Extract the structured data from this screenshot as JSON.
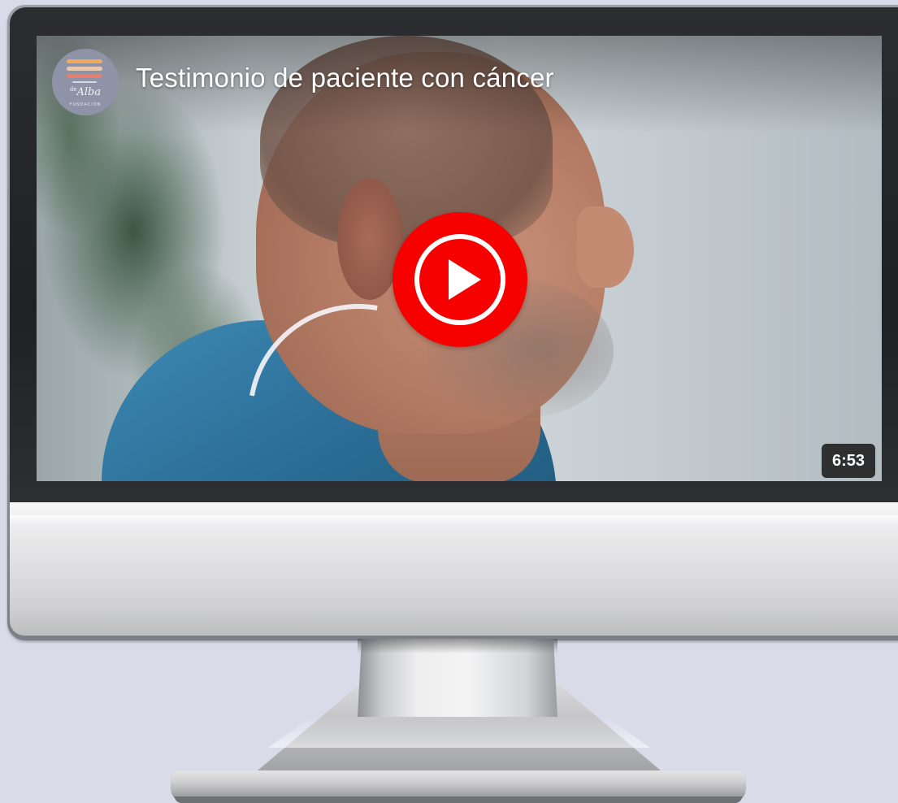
{
  "video": {
    "title": "Testimonio de paciente con cáncer",
    "duration": "6:53",
    "channel_avatar": {
      "script_text": "Alba",
      "prefix_text": "de",
      "small_text": "FUNDACIÓN"
    },
    "play_button_icon": "youtube-music-play-icon"
  },
  "colors": {
    "page_background": "#d9dbe9",
    "play_button": "#f70000",
    "bezel": "#1f2124",
    "chin": "#dcdcde"
  }
}
